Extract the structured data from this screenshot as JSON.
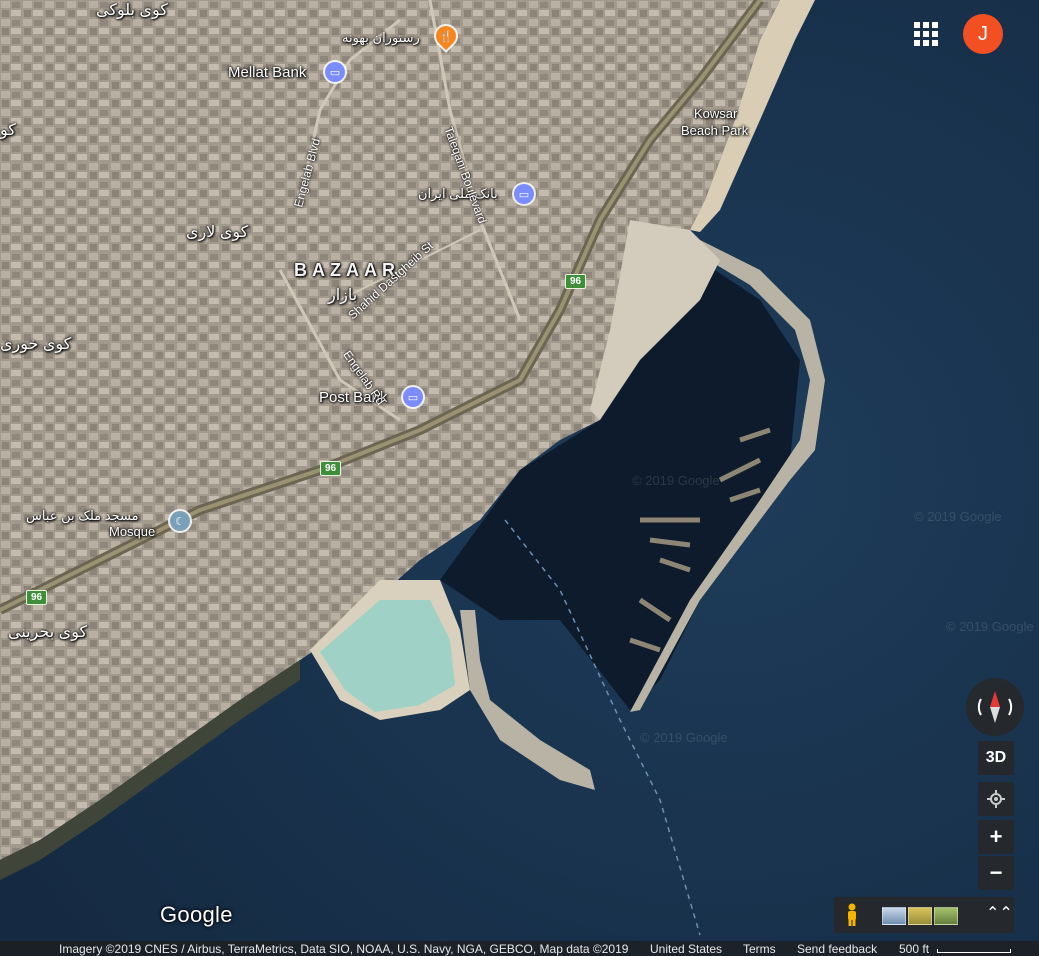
{
  "places": {
    "koy_baloki": "کوی بلوکی",
    "restaurant": "رستوران بهونه",
    "mellat_bank": "Mellat Bank",
    "kowsar_1": "Kowsar",
    "kowsar_2": "Beach Park",
    "bank_melli": "بانک ملی ایران",
    "koy_lari": "کوی لاری",
    "bazaar_en": "BAZAAR",
    "bazaar_fa": "بازار",
    "koy_khouri": "کوی خوری",
    "post_bank": "Post Bank",
    "mosque_fa": "مسجد ملک بن عباس",
    "mosque_en": "Mosque",
    "koy_bahreini": "کوی بحرینی",
    "edge_left": "کو"
  },
  "roads": {
    "engelab_blvd": "Engelab Blvd",
    "taleqani": "Taleqani Boulevard",
    "dastgheib": "Shahid Dastgheib St",
    "engelab_rd": "Engelab Rd",
    "route_96": "96"
  },
  "watermark": "© 2019 Google",
  "controls": {
    "avatar_letter": "J",
    "btn_3d": "3D",
    "zoom_in": "+",
    "zoom_out": "−",
    "expand": "⌃⌃"
  },
  "logo": "Google",
  "footer": {
    "imagery": "Imagery ©2019 CNES / Airbus, TerraMetrics, Data SIO, NOAA, U.S. Navy, NGA, GEBCO, Map data ©2019",
    "country": "United States",
    "terms": "Terms",
    "feedback": "Send feedback",
    "scale": "500 ft"
  },
  "icons": {
    "apps": "apps-grid-icon",
    "compass": "compass-icon",
    "locate": "my-location-icon",
    "pegman": "pegman-icon",
    "bank": "bank-icon",
    "restaurant": "restaurant-icon",
    "mosque": "mosque-icon"
  }
}
